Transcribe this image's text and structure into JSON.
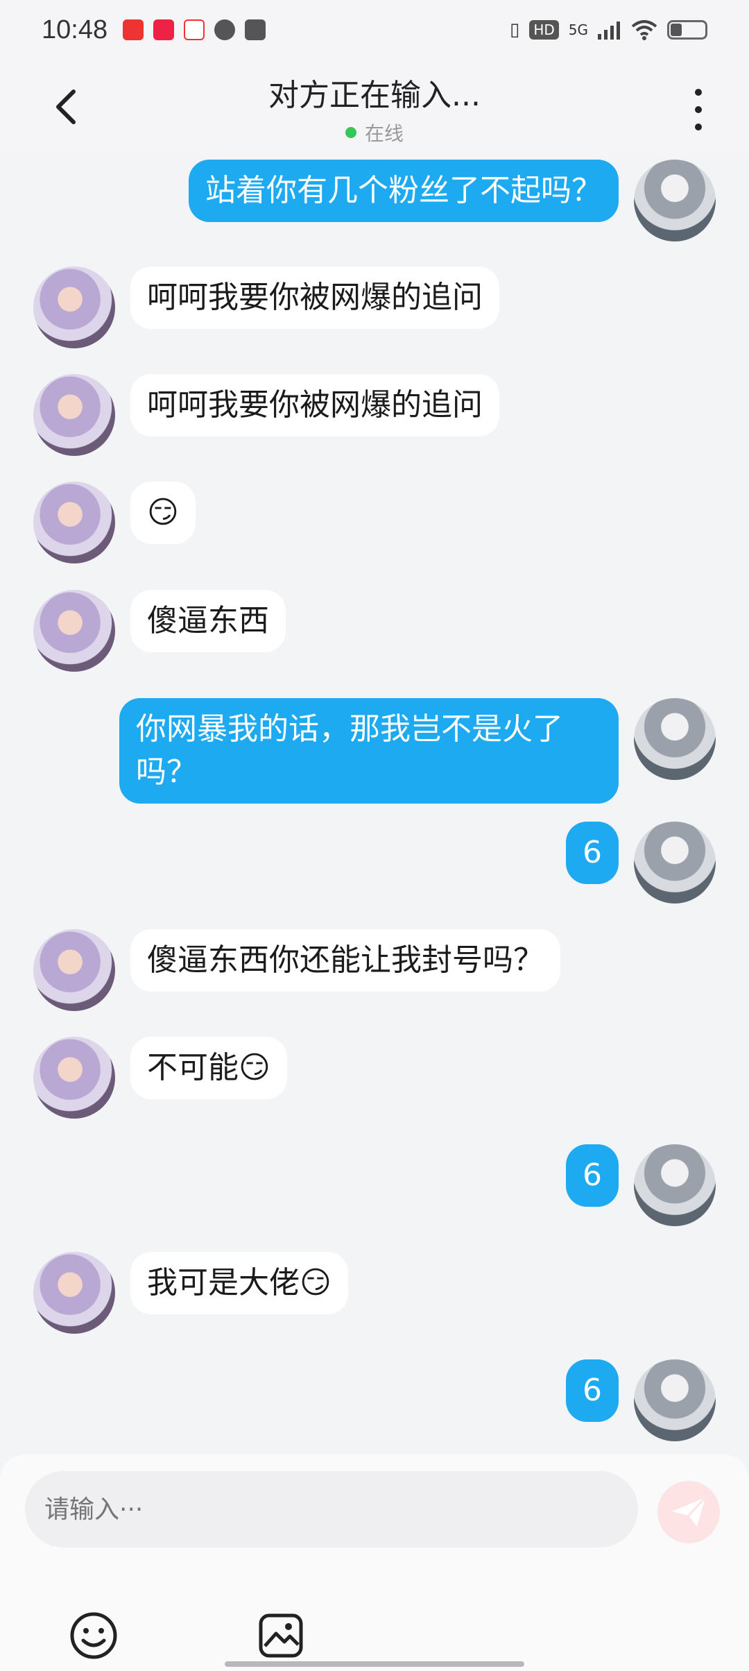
{
  "status_bar": {
    "time": "10:48",
    "icons": [
      "signal-icon",
      "wifi-icon",
      "battery-icon"
    ],
    "network": "5G",
    "hd": "HD"
  },
  "header": {
    "title": "对方正在输入...",
    "status": "在线"
  },
  "messages": [
    {
      "side": "out",
      "text": "站着你有几个粉丝了不起吗？"
    },
    {
      "side": "in",
      "text": "呵呵我要你被网爆的追问"
    },
    {
      "side": "in",
      "text": "呵呵我要你被网爆的追问"
    },
    {
      "side": "in",
      "text": "😏"
    },
    {
      "side": "in",
      "text": "傻逼东西"
    },
    {
      "side": "out",
      "text": "你网暴我的话，那我岂不是火了吗？"
    },
    {
      "side": "out",
      "text": "6"
    },
    {
      "side": "in",
      "text": "傻逼东西你还能让我封号吗？"
    },
    {
      "side": "in",
      "text": "不可能😏"
    },
    {
      "side": "out",
      "text": "6"
    },
    {
      "side": "in",
      "text": "我可是大佬😏"
    },
    {
      "side": "out",
      "text": "6"
    }
  ],
  "input": {
    "placeholder": "请输入···"
  },
  "colors": {
    "out_bubble": "#1eaaf1",
    "in_bubble": "#ffffff",
    "background": "#f3f4f6",
    "online": "#35c759",
    "send_button": "#fde3e3"
  }
}
